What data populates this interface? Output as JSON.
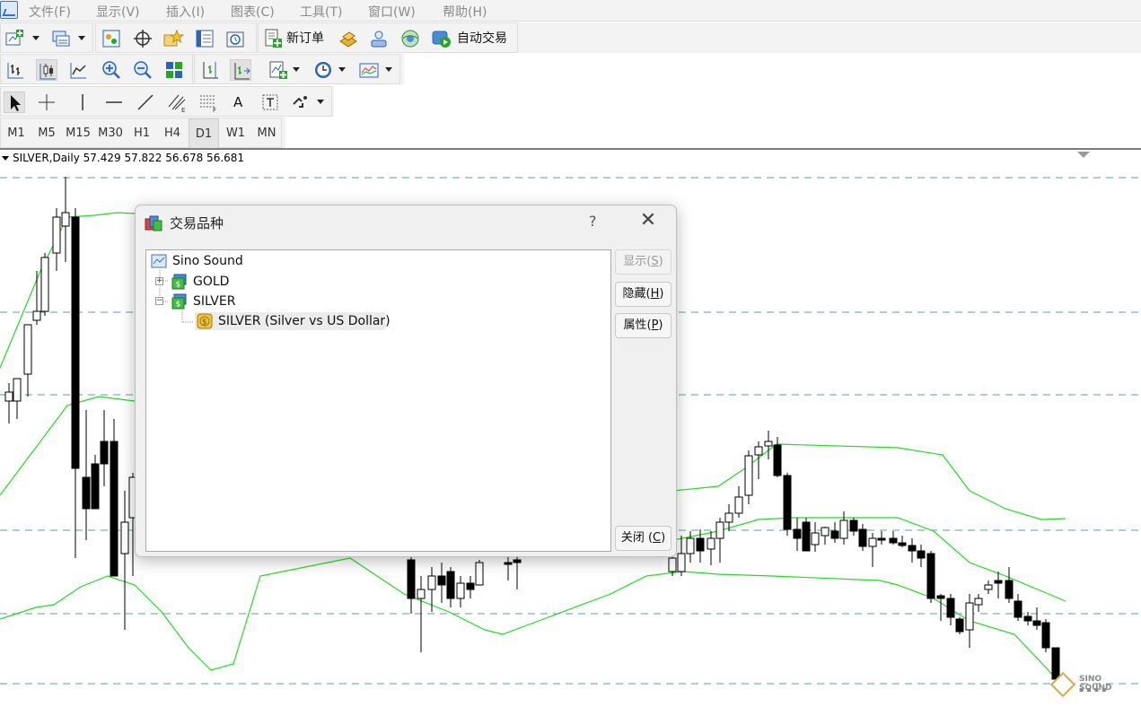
{
  "menu": {
    "items": [
      "文件(F)",
      "显示(V)",
      "插入(I)",
      "图表(C)",
      "工具(T)",
      "窗口(W)",
      "帮助(H)"
    ]
  },
  "toolbar": {
    "new_order_label": "新订单",
    "auto_trading_label": "自动交易",
    "text_tool_label": "A",
    "timeframes": [
      "M1",
      "M5",
      "M15",
      "M30",
      "H1",
      "H4",
      "D1",
      "W1",
      "MN"
    ],
    "active_timeframe": "D1"
  },
  "chart": {
    "symbol_header": "SILVER,Daily  57.429 57.822 56.678 56.681",
    "symbol": "SILVER",
    "period": "Daily",
    "open": 57.429,
    "high": 57.822,
    "low": 56.678,
    "close": 56.681,
    "band_color": "#22dd22",
    "grid_color": "#5aa0a0",
    "bull_color": "#ffffff",
    "bear_color": "#000000"
  },
  "dialog": {
    "title": "交易品种",
    "help_label": "?",
    "close_glyph": "✕",
    "tree": {
      "root": "Sino Sound",
      "groups": [
        {
          "name": "GOLD",
          "expander": "+"
        },
        {
          "name": "SILVER",
          "expander": "−"
        }
      ],
      "symbol_item": "SILVER  (Silver vs US Dollar)"
    },
    "buttons": {
      "show_text": "显示(",
      "show_key": "S",
      "show_tail": ")",
      "hide_text": "隐藏(",
      "hide_key": "H",
      "hide_tail": ")",
      "properties_text": "属性(",
      "properties_key": "P",
      "properties_tail": ")",
      "close_text": "关闭 (",
      "close_key": "C",
      "close_tail": ")"
    }
  },
  "watermark": {
    "brand": "SINO SOUND"
  }
}
